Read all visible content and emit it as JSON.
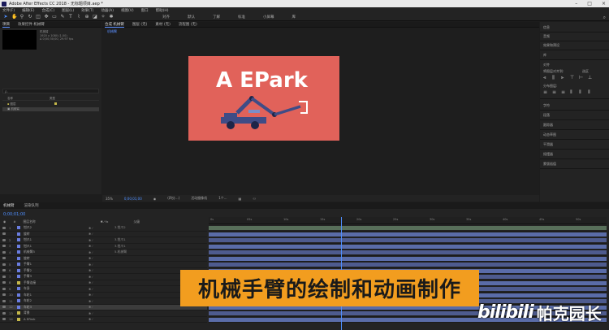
{
  "window": {
    "title": "Adobe After Effects CC 2018 - 无标题项目.aep *"
  },
  "menu": [
    "文件(F)",
    "编辑(E)",
    "合成(C)",
    "图层(L)",
    "效果(T)",
    "动画(A)",
    "视图(V)",
    "窗口",
    "帮助(H)"
  ],
  "toolbar": {
    "right_items": [
      "对齐",
      "默认",
      "了解",
      "标准",
      "小屏幕",
      "库"
    ]
  },
  "project": {
    "tabs": [
      "项目",
      "效果控件 机械臂"
    ],
    "info": [
      "机械臂",
      "1920 x 1080 (1.00)",
      "Δ 0;00;30;00, 29.97 fps"
    ],
    "search_placeholder": "ρ.",
    "columns": [
      "名称",
      "类型"
    ],
    "items": [
      {
        "name": "图层"
      },
      {
        "name": "机械臂"
      }
    ]
  },
  "composition": {
    "tabs": [
      "合成 机械臂",
      "图层 (无)",
      "素材 (无)",
      "流程图 (无)"
    ],
    "sub_tab": "机械臂",
    "canvas_text": "A EPark",
    "bottom": {
      "zoom": "35%",
      "timecode": "0;00;01;00",
      "resolution": "(四分...)",
      "camera": "活动摄像机",
      "views": "1个..."
    }
  },
  "right_panel": {
    "items": [
      "信息",
      "音频",
      "效果和预设",
      "库",
      "对齐",
      "将图层对齐到:",
      "选区",
      "分布图层:",
      "字符",
      "段落",
      "跟踪器",
      "动态草图",
      "平滑器",
      "摇摆器",
      "蒙版插值"
    ],
    "align_to": "选区"
  },
  "timeline": {
    "tabs": [
      "机械臂",
      "渲染队列"
    ],
    "current_time": "0;00;01;00",
    "columns": [
      "#",
      "图层名称",
      "父级"
    ],
    "ruler": [
      "0s",
      "05s",
      "10s",
      "15s",
      "20s",
      "25s",
      "30s",
      "35s",
      "40s",
      "45s",
      "50s"
    ],
    "layers": [
      {
        "num": "1",
        "name": "钳爪2",
        "color": "#6a7de0",
        "parent": "3.钳爪2"
      },
      {
        "num": "",
        "name": "旋转",
        "color": "#6a7de0",
        "parent": ""
      },
      {
        "num": "2",
        "name": "钳爪1",
        "color": "#6a7de0",
        "parent": "3.钳爪1"
      },
      {
        "num": "3",
        "name": "钳爪1",
        "color": "#6a7de0",
        "parent": "3.钳爪1"
      },
      {
        "num": "4",
        "name": "机械臂3",
        "color": "#6a7de0",
        "parent": "5.机械臂"
      },
      {
        "num": "",
        "name": "旋转",
        "color": "#6a7de0",
        "parent": ""
      },
      {
        "num": "5",
        "name": "手臂1",
        "color": "#6a7de0",
        "parent": ""
      },
      {
        "num": "6",
        "name": "手臂2",
        "color": "#6a7de0",
        "parent": ""
      },
      {
        "num": "7",
        "name": "手臂3",
        "color": "#6a7de0",
        "parent": ""
      },
      {
        "num": "8",
        "name": "手臂连接",
        "color": "#c5b84a",
        "parent": ""
      },
      {
        "num": "9",
        "name": "车身",
        "color": "#6a7de0",
        "parent": ""
      },
      {
        "num": "10",
        "name": "车轮1",
        "color": "#6a7de0",
        "parent": ""
      },
      {
        "num": "11",
        "name": "车轮2",
        "color": "#6a7de0",
        "parent": ""
      },
      {
        "num": "12",
        "name": "车轮3",
        "color": "#6a7de0",
        "parent": ""
      },
      {
        "num": "13",
        "name": "背景",
        "color": "#c5b84a",
        "parent": ""
      },
      {
        "num": "14",
        "name": "A EPark",
        "color": "#c5b84a",
        "parent": ""
      }
    ]
  },
  "subtitle": "机械手臂的绘制和动画制作",
  "watermark": {
    "logo": "bilibili",
    "text": "帕克园长"
  },
  "colors": {
    "canvas_bg": "#e1625a",
    "arm_blue": "#3f4c86",
    "accent": "#4f8fff",
    "banner": "#f29d1f"
  }
}
